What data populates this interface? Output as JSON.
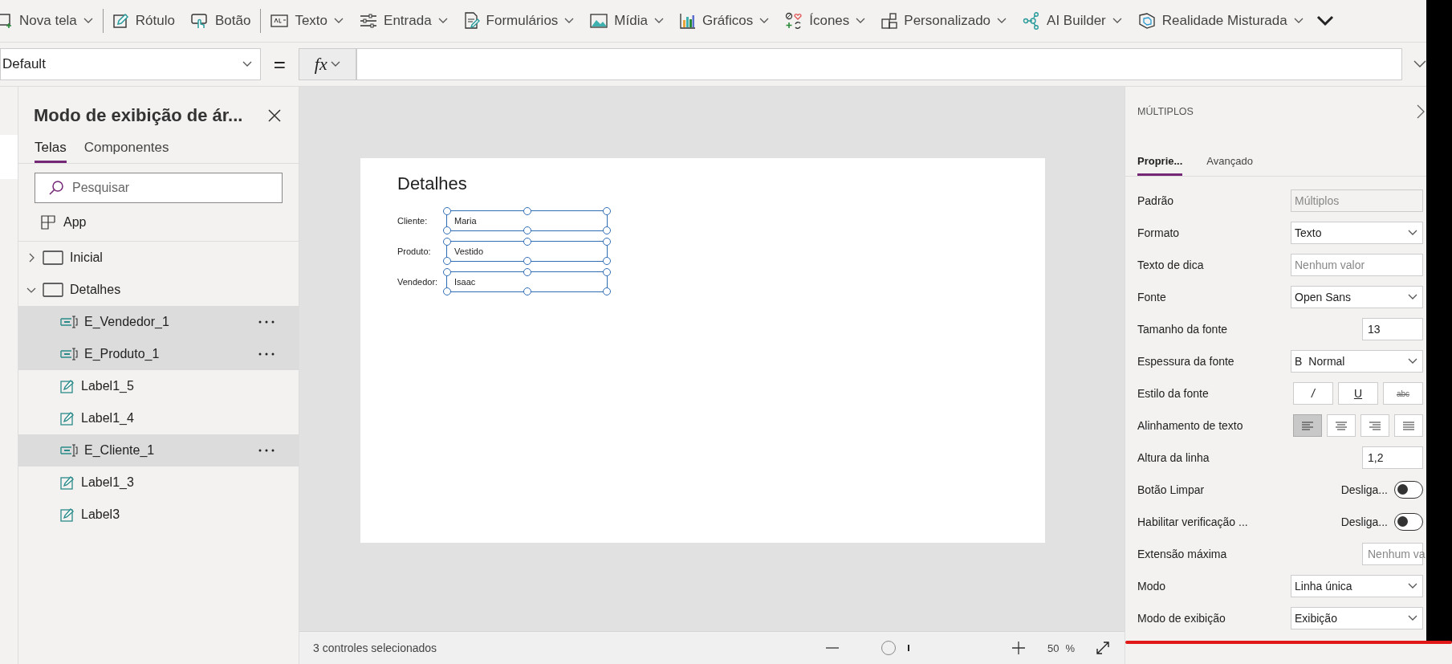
{
  "toolbar": [
    {
      "label": "Nova tela",
      "dropdown": true
    },
    {
      "label": "Rótulo",
      "dropdown": false
    },
    {
      "label": "Botão",
      "dropdown": false
    },
    {
      "label": "Texto",
      "dropdown": true
    },
    {
      "label": "Entrada",
      "dropdown": true
    },
    {
      "label": "Formulários",
      "dropdown": true
    },
    {
      "label": "Mídia",
      "dropdown": true
    },
    {
      "label": "Gráficos",
      "dropdown": true
    },
    {
      "label": "Ícones",
      "dropdown": true
    },
    {
      "label": "Personalizado",
      "dropdown": true
    },
    {
      "label": "AI Builder",
      "dropdown": true
    },
    {
      "label": "Realidade Misturada",
      "dropdown": true
    }
  ],
  "formula_bar": {
    "property": "Default",
    "equals": "=",
    "fx": "fx"
  },
  "tree_panel": {
    "title": "Modo de exibição de ár...",
    "tabs": [
      {
        "label": "Telas",
        "selected": true
      },
      {
        "label": "Componentes",
        "selected": false
      }
    ],
    "search": {
      "placeholder": "Pesquisar"
    },
    "app": "App",
    "screens": [
      {
        "label": "Inicial",
        "expanded": false
      },
      {
        "label": "Detalhes",
        "expanded": true,
        "children": [
          {
            "label": "E_Vendedor_1",
            "kind": "input",
            "selected": true
          },
          {
            "label": "E_Produto_1",
            "kind": "input",
            "selected": true
          },
          {
            "label": "Label1_5",
            "kind": "label",
            "selected": false
          },
          {
            "label": "Label1_4",
            "kind": "label",
            "selected": false
          },
          {
            "label": "E_Cliente_1",
            "kind": "input",
            "selected": true
          },
          {
            "label": "Label1_3",
            "kind": "label",
            "selected": false
          },
          {
            "label": "Label3",
            "kind": "label",
            "selected": false
          }
        ]
      }
    ]
  },
  "canvas": {
    "title": "Detalhes",
    "fields": [
      {
        "label": "Cliente:",
        "value": "Maria",
        "selected": true
      },
      {
        "label": "Produto:",
        "value": "Vestido",
        "selected": true
      },
      {
        "label": "Vendedor:",
        "value": "Isaac",
        "selected": true
      }
    ]
  },
  "status_bar": {
    "text": "3 controles selecionados",
    "zoom_slider": {
      "level": 0.13
    },
    "zoom": "50",
    "percent": "%"
  },
  "properties": {
    "heading": "MÚLTIPLOS",
    "tabs": [
      {
        "label": "Proprie...",
        "selected": true
      },
      {
        "label": "Avançado",
        "selected": false
      }
    ],
    "rows": [
      {
        "label": "Padrão",
        "kind": "readonly",
        "placeholder": "Múltiplos"
      },
      {
        "label": "Formato",
        "kind": "dropdown",
        "value": "Texto"
      },
      {
        "label": "Texto de dica",
        "kind": "text",
        "placeholder": "Nenhum valor"
      },
      {
        "label": "Fonte",
        "kind": "dropdown",
        "value": "Open Sans"
      },
      {
        "label": "Tamanho da fonte",
        "kind": "number",
        "value": "13"
      },
      {
        "label": "Espessura da fonte",
        "kind": "dropdown",
        "prefix": "B",
        "value": "Normal"
      },
      {
        "label": "Estilo da fonte",
        "kind": "buttons",
        "buttons": [
          {
            "label": "/",
            "selected": false
          },
          {
            "label": "U",
            "selected": false
          },
          {
            "label": "abc",
            "selected": false
          }
        ]
      },
      {
        "label": "Alinhamento de texto",
        "kind": "align",
        "options": [
          {
            "selected": true
          },
          {
            "selected": false
          },
          {
            "selected": false
          },
          {
            "selected": false
          }
        ]
      },
      {
        "label": "Altura da linha",
        "kind": "number",
        "value": "1,2"
      },
      {
        "label": "Botão Limpar",
        "kind": "toggle",
        "state_label": "Desliga...",
        "on": false
      },
      {
        "label": "Habilitar verificação ...",
        "kind": "toggle",
        "state_label": "Desliga...",
        "on": false
      },
      {
        "label": "Extensão máxima",
        "kind": "number",
        "placeholder": "Nenhum va"
      },
      {
        "label": "Modo",
        "kind": "dropdown",
        "value": "Linha única"
      },
      {
        "label": "Modo de exibição",
        "kind": "dropdown",
        "value": "Exibição"
      }
    ]
  }
}
